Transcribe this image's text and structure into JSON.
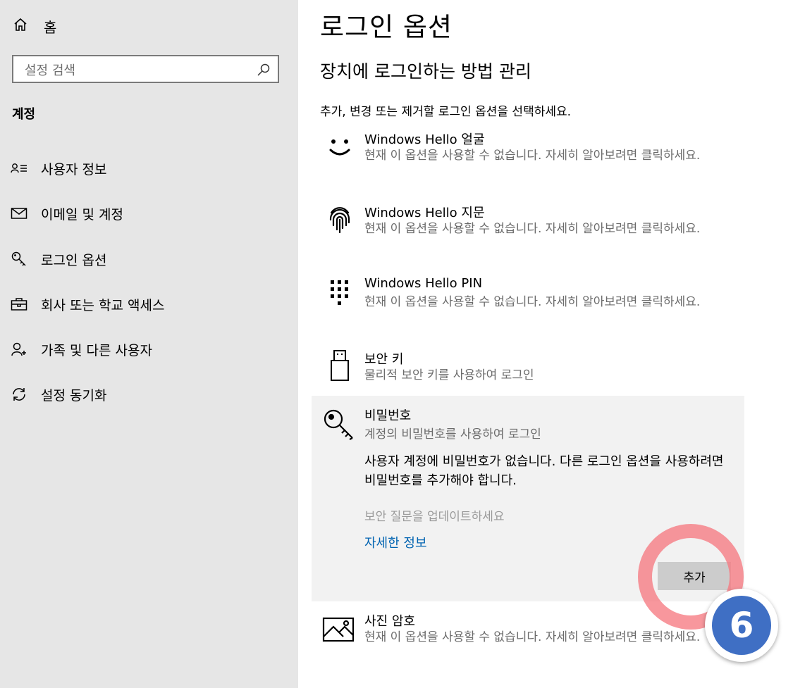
{
  "sidebar": {
    "home_label": "홈",
    "search": {
      "placeholder": "설정 검색"
    },
    "section_title": "계정",
    "items": [
      {
        "label": "사용자 정보",
        "icon": "user-info-icon"
      },
      {
        "label": "이메일 및 계정",
        "icon": "mail-icon"
      },
      {
        "label": "로그인 옵션",
        "icon": "key-icon"
      },
      {
        "label": "회사 또는 학교 액세스",
        "icon": "briefcase-icon"
      },
      {
        "label": "가족 및 다른 사용자",
        "icon": "add-user-icon"
      },
      {
        "label": "설정 동기화",
        "icon": "sync-icon"
      }
    ]
  },
  "main": {
    "title": "로그인 옵션",
    "subtitle": "장치에 로그인하는 방법 관리",
    "intro": "추가, 변경 또는 제거할 로그인 옵션을 선택하세요.",
    "options": [
      {
        "title": "Windows Hello 얼굴",
        "desc": "현재 이 옵션을 사용할 수 없습니다. 자세히 알아보려면 클릭하세요.",
        "icon": "face-icon"
      },
      {
        "title": "Windows Hello 지문",
        "desc": "현재 이 옵션을 사용할 수 없습니다. 자세히 알아보려면 클릭하세요.",
        "icon": "fingerprint-icon"
      },
      {
        "title": "Windows Hello PIN",
        "desc": "현재 이 옵션을 사용할 수 없습니다. 자세히 알아보려면 클릭하세요.",
        "icon": "pin-keypad-icon"
      },
      {
        "title": "보안 키",
        "desc": "물리적 보안 키를 사용하여 로그인",
        "icon": "usb-key-icon"
      }
    ],
    "password": {
      "title": "비밀번호",
      "desc": "계정의 비밀번호를 사용하여 로그인",
      "message": "사용자 계정에 비밀번호가 없습니다. 다른 로그인 옵션을 사용하려면 비밀번호를 추가해야 합니다.",
      "security_question": "보안 질문을 업데이트하세요",
      "more_info": "자세한 정보",
      "add_button": "추가",
      "icon": "key-icon"
    },
    "picture_password": {
      "title": "사진 암호",
      "desc": "현재 이 옵션을 사용할 수 없습니다. 자세히 알아보려면 클릭하세요.",
      "icon": "picture-icon"
    }
  },
  "overlay": {
    "step_number": "6",
    "ring_color": "#f67a82",
    "badge_color": "#3f6fc4"
  }
}
